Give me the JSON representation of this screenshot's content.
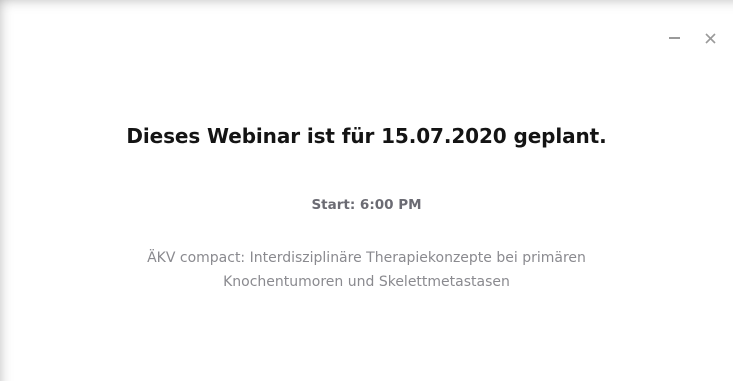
{
  "window": {
    "controls": {
      "minimize_icon": "minimize-icon",
      "close_icon": "close-icon"
    }
  },
  "dialog": {
    "title": "Dieses Webinar ist für 15.07.2020 geplant.",
    "start": "Start: 6:00 PM",
    "topic_line1": "ÄKV compact: Interdisziplinäre Therapiekonzepte bei primären",
    "topic_line2": "Knochentumoren und Skelettmetastasen"
  },
  "colors": {
    "background": "#ffffff",
    "title": "#141414",
    "start": "#6b6b73",
    "topic": "#8a8a8f",
    "controls": "#9a9a9a"
  }
}
